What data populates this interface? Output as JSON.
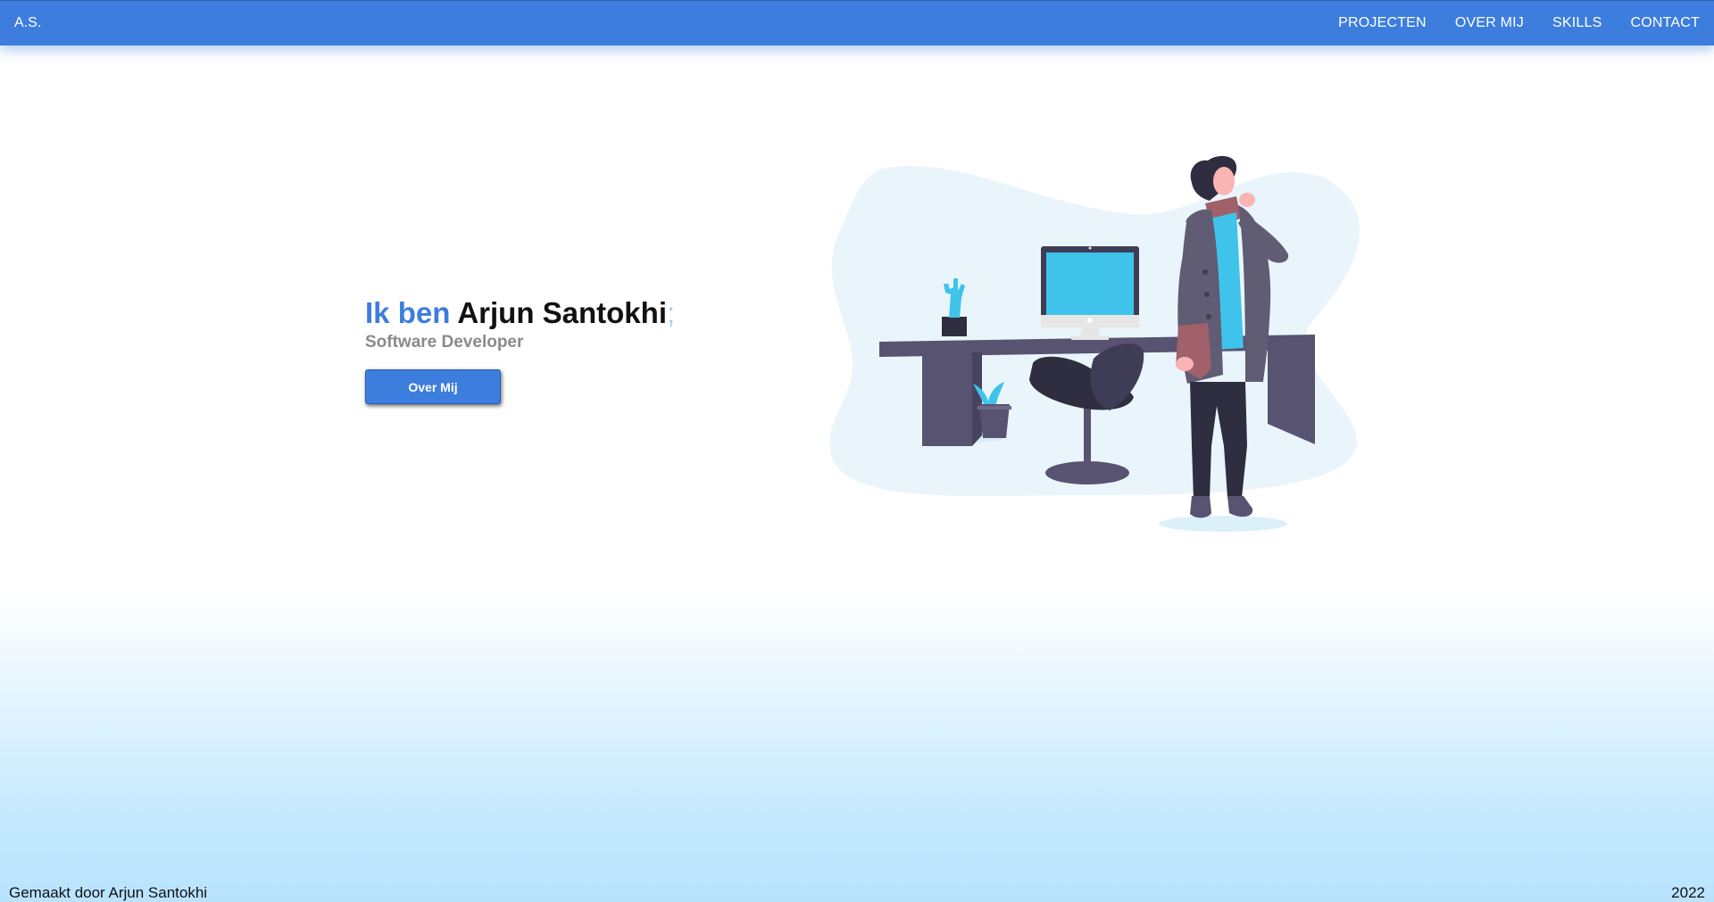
{
  "nav": {
    "brand": "A.S.",
    "links": [
      {
        "label": "PROJECTEN"
      },
      {
        "label": "OVER MIJ"
      },
      {
        "label": "SKILLS"
      },
      {
        "label": "CONTACT"
      }
    ]
  },
  "hero": {
    "greeting": "Ik ben",
    "name": "Arjun Santokhi",
    "cursor": ";",
    "subtitle": "Software Developer",
    "button_label": "Over Mij"
  },
  "illustration": {
    "icon": "person-at-desk-illustration",
    "colors": {
      "blob": "#e9f5fb",
      "desk": "#575370",
      "screen": "#3fc3ea",
      "accent": "#3fc3ea",
      "coat": "#5f5c73"
    }
  },
  "footer": {
    "credit": "Gemaakt door Arjun Santokhi",
    "year": "2022"
  },
  "colors": {
    "accent": "#3d7ddd",
    "subtitle": "#8a8a8a",
    "cursor": "#a8cdf5",
    "gradient_bottom": "#b9e3fd"
  }
}
